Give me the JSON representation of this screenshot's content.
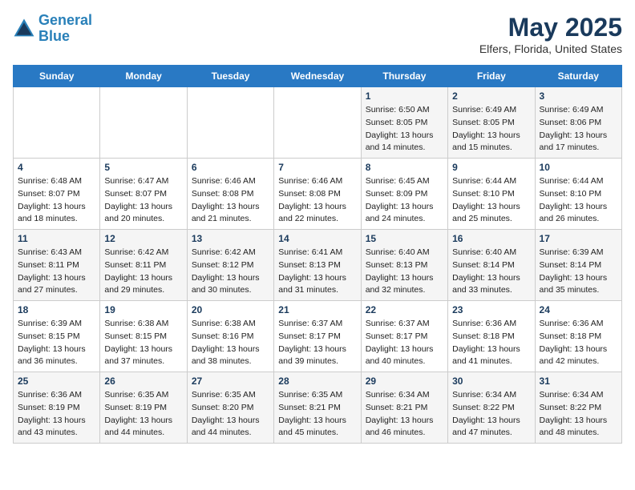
{
  "header": {
    "logo_line1": "General",
    "logo_line2": "Blue",
    "month": "May 2025",
    "location": "Elfers, Florida, United States"
  },
  "weekdays": [
    "Sunday",
    "Monday",
    "Tuesday",
    "Wednesday",
    "Thursday",
    "Friday",
    "Saturday"
  ],
  "weeks": [
    [
      {
        "day": "",
        "info": ""
      },
      {
        "day": "",
        "info": ""
      },
      {
        "day": "",
        "info": ""
      },
      {
        "day": "",
        "info": ""
      },
      {
        "day": "1",
        "info": "Sunrise: 6:50 AM\nSunset: 8:05 PM\nDaylight: 13 hours\nand 14 minutes."
      },
      {
        "day": "2",
        "info": "Sunrise: 6:49 AM\nSunset: 8:05 PM\nDaylight: 13 hours\nand 15 minutes."
      },
      {
        "day": "3",
        "info": "Sunrise: 6:49 AM\nSunset: 8:06 PM\nDaylight: 13 hours\nand 17 minutes."
      }
    ],
    [
      {
        "day": "4",
        "info": "Sunrise: 6:48 AM\nSunset: 8:07 PM\nDaylight: 13 hours\nand 18 minutes."
      },
      {
        "day": "5",
        "info": "Sunrise: 6:47 AM\nSunset: 8:07 PM\nDaylight: 13 hours\nand 20 minutes."
      },
      {
        "day": "6",
        "info": "Sunrise: 6:46 AM\nSunset: 8:08 PM\nDaylight: 13 hours\nand 21 minutes."
      },
      {
        "day": "7",
        "info": "Sunrise: 6:46 AM\nSunset: 8:08 PM\nDaylight: 13 hours\nand 22 minutes."
      },
      {
        "day": "8",
        "info": "Sunrise: 6:45 AM\nSunset: 8:09 PM\nDaylight: 13 hours\nand 24 minutes."
      },
      {
        "day": "9",
        "info": "Sunrise: 6:44 AM\nSunset: 8:10 PM\nDaylight: 13 hours\nand 25 minutes."
      },
      {
        "day": "10",
        "info": "Sunrise: 6:44 AM\nSunset: 8:10 PM\nDaylight: 13 hours\nand 26 minutes."
      }
    ],
    [
      {
        "day": "11",
        "info": "Sunrise: 6:43 AM\nSunset: 8:11 PM\nDaylight: 13 hours\nand 27 minutes."
      },
      {
        "day": "12",
        "info": "Sunrise: 6:42 AM\nSunset: 8:11 PM\nDaylight: 13 hours\nand 29 minutes."
      },
      {
        "day": "13",
        "info": "Sunrise: 6:42 AM\nSunset: 8:12 PM\nDaylight: 13 hours\nand 30 minutes."
      },
      {
        "day": "14",
        "info": "Sunrise: 6:41 AM\nSunset: 8:13 PM\nDaylight: 13 hours\nand 31 minutes."
      },
      {
        "day": "15",
        "info": "Sunrise: 6:40 AM\nSunset: 8:13 PM\nDaylight: 13 hours\nand 32 minutes."
      },
      {
        "day": "16",
        "info": "Sunrise: 6:40 AM\nSunset: 8:14 PM\nDaylight: 13 hours\nand 33 minutes."
      },
      {
        "day": "17",
        "info": "Sunrise: 6:39 AM\nSunset: 8:14 PM\nDaylight: 13 hours\nand 35 minutes."
      }
    ],
    [
      {
        "day": "18",
        "info": "Sunrise: 6:39 AM\nSunset: 8:15 PM\nDaylight: 13 hours\nand 36 minutes."
      },
      {
        "day": "19",
        "info": "Sunrise: 6:38 AM\nSunset: 8:15 PM\nDaylight: 13 hours\nand 37 minutes."
      },
      {
        "day": "20",
        "info": "Sunrise: 6:38 AM\nSunset: 8:16 PM\nDaylight: 13 hours\nand 38 minutes."
      },
      {
        "day": "21",
        "info": "Sunrise: 6:37 AM\nSunset: 8:17 PM\nDaylight: 13 hours\nand 39 minutes."
      },
      {
        "day": "22",
        "info": "Sunrise: 6:37 AM\nSunset: 8:17 PM\nDaylight: 13 hours\nand 40 minutes."
      },
      {
        "day": "23",
        "info": "Sunrise: 6:36 AM\nSunset: 8:18 PM\nDaylight: 13 hours\nand 41 minutes."
      },
      {
        "day": "24",
        "info": "Sunrise: 6:36 AM\nSunset: 8:18 PM\nDaylight: 13 hours\nand 42 minutes."
      }
    ],
    [
      {
        "day": "25",
        "info": "Sunrise: 6:36 AM\nSunset: 8:19 PM\nDaylight: 13 hours\nand 43 minutes."
      },
      {
        "day": "26",
        "info": "Sunrise: 6:35 AM\nSunset: 8:19 PM\nDaylight: 13 hours\nand 44 minutes."
      },
      {
        "day": "27",
        "info": "Sunrise: 6:35 AM\nSunset: 8:20 PM\nDaylight: 13 hours\nand 44 minutes."
      },
      {
        "day": "28",
        "info": "Sunrise: 6:35 AM\nSunset: 8:21 PM\nDaylight: 13 hours\nand 45 minutes."
      },
      {
        "day": "29",
        "info": "Sunrise: 6:34 AM\nSunset: 8:21 PM\nDaylight: 13 hours\nand 46 minutes."
      },
      {
        "day": "30",
        "info": "Sunrise: 6:34 AM\nSunset: 8:22 PM\nDaylight: 13 hours\nand 47 minutes."
      },
      {
        "day": "31",
        "info": "Sunrise: 6:34 AM\nSunset: 8:22 PM\nDaylight: 13 hours\nand 48 minutes."
      }
    ]
  ]
}
